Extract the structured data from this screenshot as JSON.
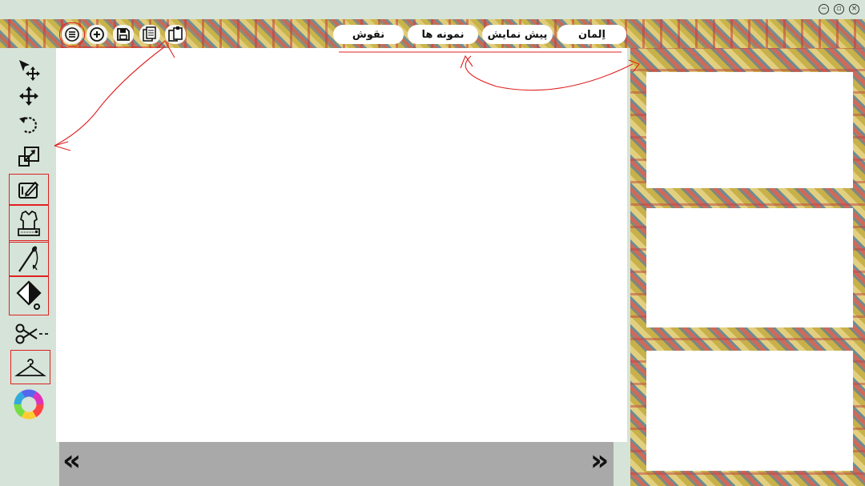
{
  "window": {
    "minimize_icon": "minus-circle",
    "restore_icon": "restore-circle",
    "close_icon": "x-circle"
  },
  "toolbar": {
    "icons": [
      "menu-icon",
      "add-icon",
      "save-icon",
      "document-icon",
      "paste-icon"
    ],
    "tabs": [
      {
        "label": "اِلمان"
      },
      {
        "label": "پیش نمایش"
      },
      {
        "label": "نمونه ها"
      },
      {
        "label": "نقوش"
      }
    ]
  },
  "tools": [
    "select-move-icon",
    "move-icon",
    "rotate-icon",
    "scale-icon",
    "tablet-draw-icon",
    "sewing-machine-icon",
    "needle-icon",
    "fill-icon",
    "scissors-icon",
    "hanger-icon",
    "color-wheel-icon"
  ],
  "bottom": {
    "prev": "«",
    "next": "»"
  },
  "colors": {
    "background": "#d6e3d8",
    "annotation": "#e02020",
    "bottom_bar": "#a9a9a9"
  }
}
